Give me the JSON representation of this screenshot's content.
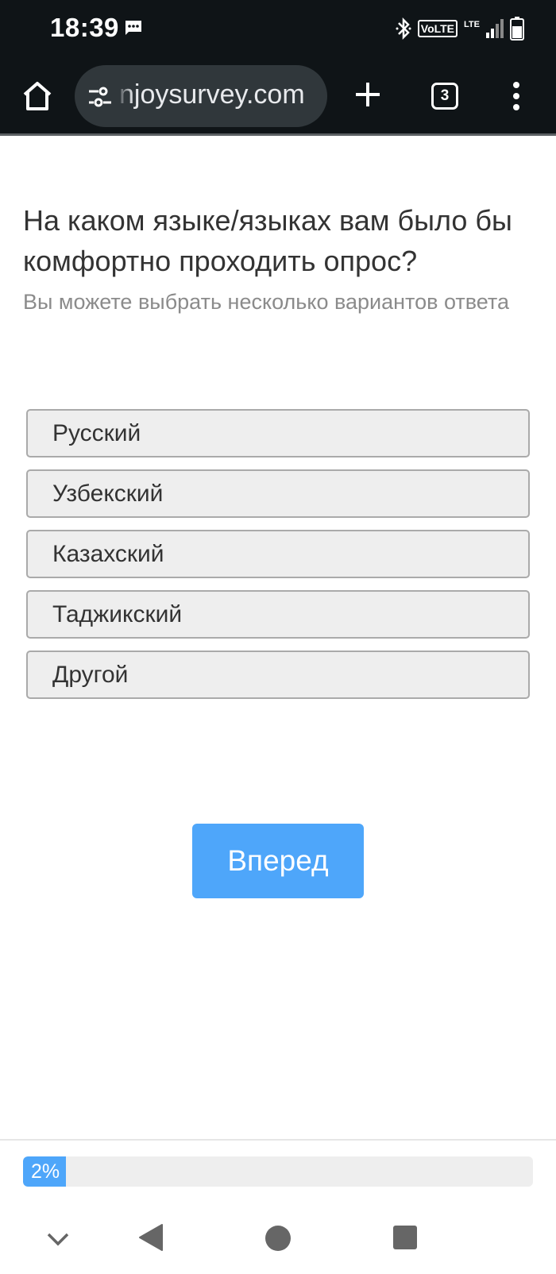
{
  "status_bar": {
    "time": "18:39",
    "volte": "VoLTE",
    "lte": "LTE",
    "icons": [
      "message-icon",
      "bluetooth-icon",
      "signal-icon",
      "battery-icon"
    ]
  },
  "browser": {
    "url": "njoysurvey.com",
    "tab_count": "3",
    "icons": [
      "home-icon",
      "tune-icon",
      "plus-icon",
      "more-vert-icon"
    ]
  },
  "survey": {
    "question": "На каком языке/языках вам было бы комфортно проходить опрос?",
    "hint": "Вы можете выбрать несколько вариантов ответа",
    "options": [
      "Русский",
      "Узбекский",
      "Казахский",
      "Таджикский",
      "Другой"
    ],
    "next_label": "Вперед"
  },
  "progress": {
    "percent": 2,
    "label": "2%"
  },
  "colors": {
    "accent": "#4ea6fa",
    "bar_bg": "#0f1417",
    "url_bg": "#30373b",
    "option_bg": "#eeeeee"
  },
  "nav_bar": {
    "icons": [
      "chevron-down-icon",
      "back-icon",
      "home-circle-icon",
      "recents-icon"
    ]
  }
}
